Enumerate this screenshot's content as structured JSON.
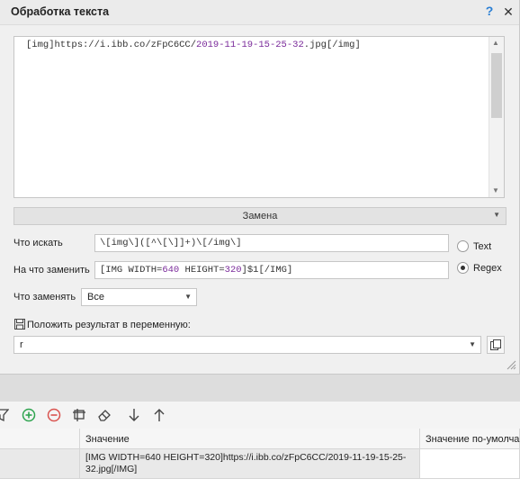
{
  "dialog": {
    "title": "Обработка текста",
    "help_icon": "?",
    "close_icon": "✕"
  },
  "input_text": {
    "prefix": "[img]https://i.ibb.co/zFpC6CC/",
    "number": "2019-11-19-15-25-32",
    "suffix": ".jpg[/img]"
  },
  "operation": {
    "selected": "Замена"
  },
  "form": {
    "find_label": "Что искать",
    "find_value": "\\[img\\]([^\\[\\]]+)\\[/img\\]",
    "replace_label": "На что заменить",
    "replace_pre": "[IMG WIDTH=",
    "replace_num1": "640",
    "replace_mid": " HEIGHT=",
    "replace_num2": "320",
    "replace_post": "]$1[/IMG]",
    "mode_text": "Text",
    "mode_regex": "Regex",
    "mode_selected": "Regex",
    "replace_what_label": "Что заменять",
    "replace_what_value": "Все",
    "save_to_var_label": "Положить результат в переменную:",
    "variable_value": "r"
  },
  "grid": {
    "columns": [
      "Значение",
      "Значение по-умолчанию"
    ],
    "rows": [
      {
        "value": "[IMG WIDTH=640 HEIGHT=320]https://i.ibb.co/zFpC6CC/2019-11-19-15-25-32.jpg[/IMG]",
        "default": ""
      }
    ]
  },
  "colors": {
    "help": "#2a7fd4",
    "number_highlight": "#7a2a9a",
    "add_green": "#2ea44f",
    "remove_red": "#d9534f"
  }
}
